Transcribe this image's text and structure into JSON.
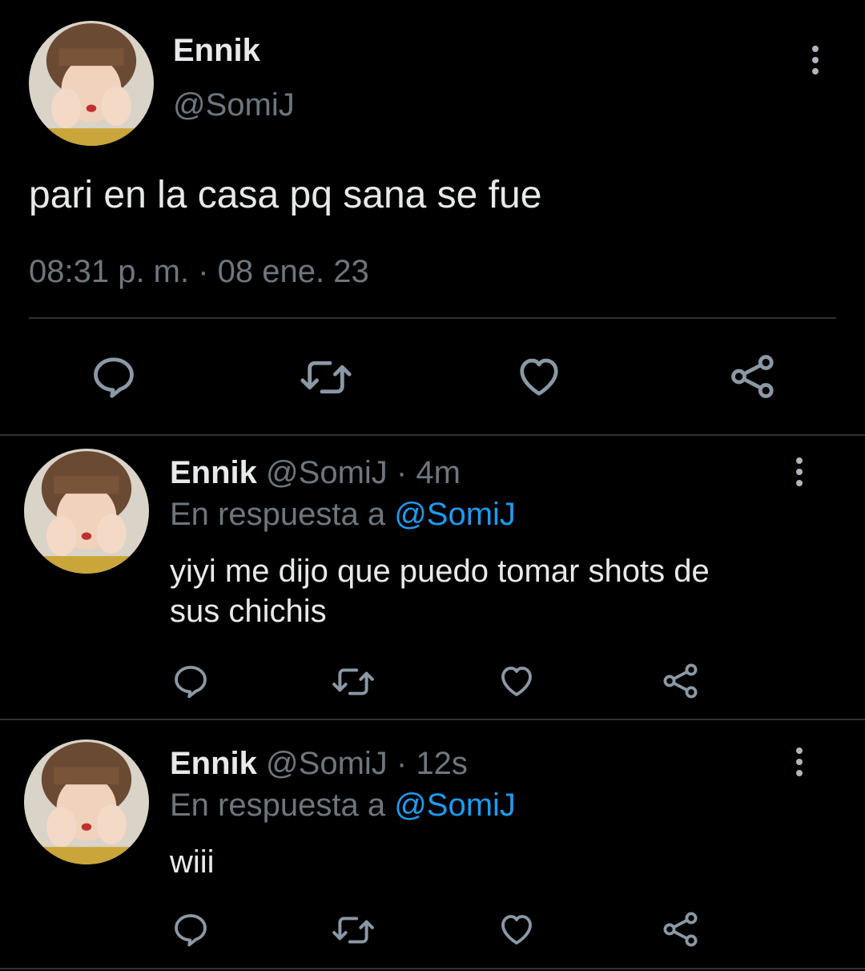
{
  "main_tweet": {
    "display_name": "Ennik",
    "handle": "@SomiJ",
    "text": "pari en la casa pq sana se fue",
    "timestamp": "08:31 p. m. · 08 ene. 23",
    "more_icon": "more-vertical-icon",
    "actions": [
      "reply-icon",
      "retweet-icon",
      "like-icon",
      "share-icon"
    ]
  },
  "replies": [
    {
      "display_name": "Ennik",
      "handle": "@SomiJ",
      "time": "· 4m",
      "reply_prefix": "En respuesta a",
      "reply_to": "@SomiJ",
      "text_line1": "yiyi me dijo que puedo tomar shots de",
      "text_line2": "sus chichis"
    },
    {
      "display_name": "Ennik",
      "handle": "@SomiJ",
      "time": "· 12s",
      "reply_prefix": "En respuesta a",
      "reply_to": "@SomiJ",
      "text_line1": "wiii",
      "text_line2": ""
    }
  ],
  "colors": {
    "background": "#000000",
    "text": "#e7e9ea",
    "muted": "#6e767d",
    "link": "#1d9bf0",
    "divider": "#2f3336"
  }
}
